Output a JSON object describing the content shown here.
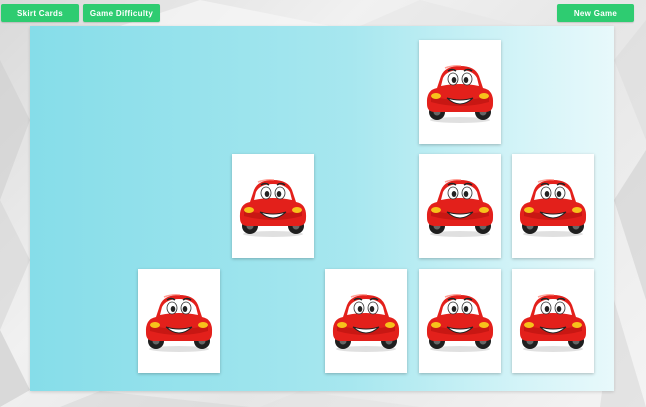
{
  "toolbar": {
    "skirt_cards_label": "Skirt Cards",
    "game_difficulty_label": "Game Difficulty",
    "new_game_label": "New Game"
  },
  "colors": {
    "button": "#2ecc71",
    "board_left": "#86dde9",
    "board_right": "#e8f9fb",
    "car_body": "#e3201b"
  },
  "board": {
    "cards": [
      {
        "id": "r0c3",
        "row": 0,
        "col": 3,
        "image": "red-cartoon-car-icon"
      },
      {
        "id": "r1c1",
        "row": 1,
        "col": 1,
        "image": "red-cartoon-car-icon"
      },
      {
        "id": "r1c3",
        "row": 1,
        "col": 3,
        "image": "red-cartoon-car-icon"
      },
      {
        "id": "r1c4",
        "row": 1,
        "col": 4,
        "image": "red-cartoon-car-icon"
      },
      {
        "id": "r2c0",
        "row": 2,
        "col": 0,
        "image": "red-cartoon-car-icon"
      },
      {
        "id": "r2c2",
        "row": 2,
        "col": 2,
        "image": "red-cartoon-car-icon"
      },
      {
        "id": "r2c3",
        "row": 2,
        "col": 3,
        "image": "red-cartoon-car-icon"
      },
      {
        "id": "r2c4",
        "row": 2,
        "col": 4,
        "image": "red-cartoon-car-icon"
      }
    ]
  }
}
